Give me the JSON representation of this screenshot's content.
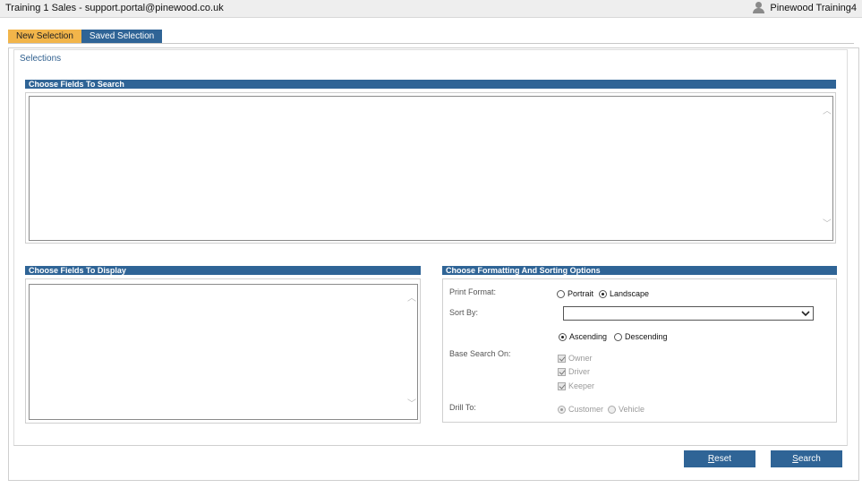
{
  "header": {
    "app_title": "Training 1 Sales - support.portal@pinewood.co.uk",
    "user_name": "Pinewood Training4",
    "user_icon": "user-icon"
  },
  "tabs": [
    {
      "label": "New Selection",
      "active": true
    },
    {
      "label": "Saved Selection",
      "active": false
    }
  ],
  "section_title": "Selections",
  "search_fields": {
    "header": "Choose Fields To Search",
    "items": []
  },
  "display_fields": {
    "header": "Choose Fields To Display",
    "items": []
  },
  "formatting": {
    "header": "Choose Formatting And Sorting Options",
    "print_format": {
      "label": "Print Format:",
      "options": [
        "Portrait",
        "Landscape"
      ],
      "selected": "Landscape"
    },
    "sort_by": {
      "label": "Sort By:",
      "value": ""
    },
    "sort_order": {
      "options": [
        "Ascending",
        "Descending"
      ],
      "selected": "Ascending"
    },
    "base_search_on": {
      "label": "Base Search On:",
      "options": [
        {
          "label": "Owner",
          "checked": true
        },
        {
          "label": "Driver",
          "checked": true
        },
        {
          "label": "Keeper",
          "checked": true
        }
      ]
    },
    "drill_to": {
      "label": "Drill To:",
      "options": [
        "Customer",
        "Vehicle"
      ],
      "selected": "Customer"
    }
  },
  "buttons": {
    "reset_first": "R",
    "reset_rest": "eset",
    "search_first": "S",
    "search_rest": "earch"
  },
  "colors": {
    "accent": "#2f6496",
    "active_tab": "#f2b54a"
  }
}
